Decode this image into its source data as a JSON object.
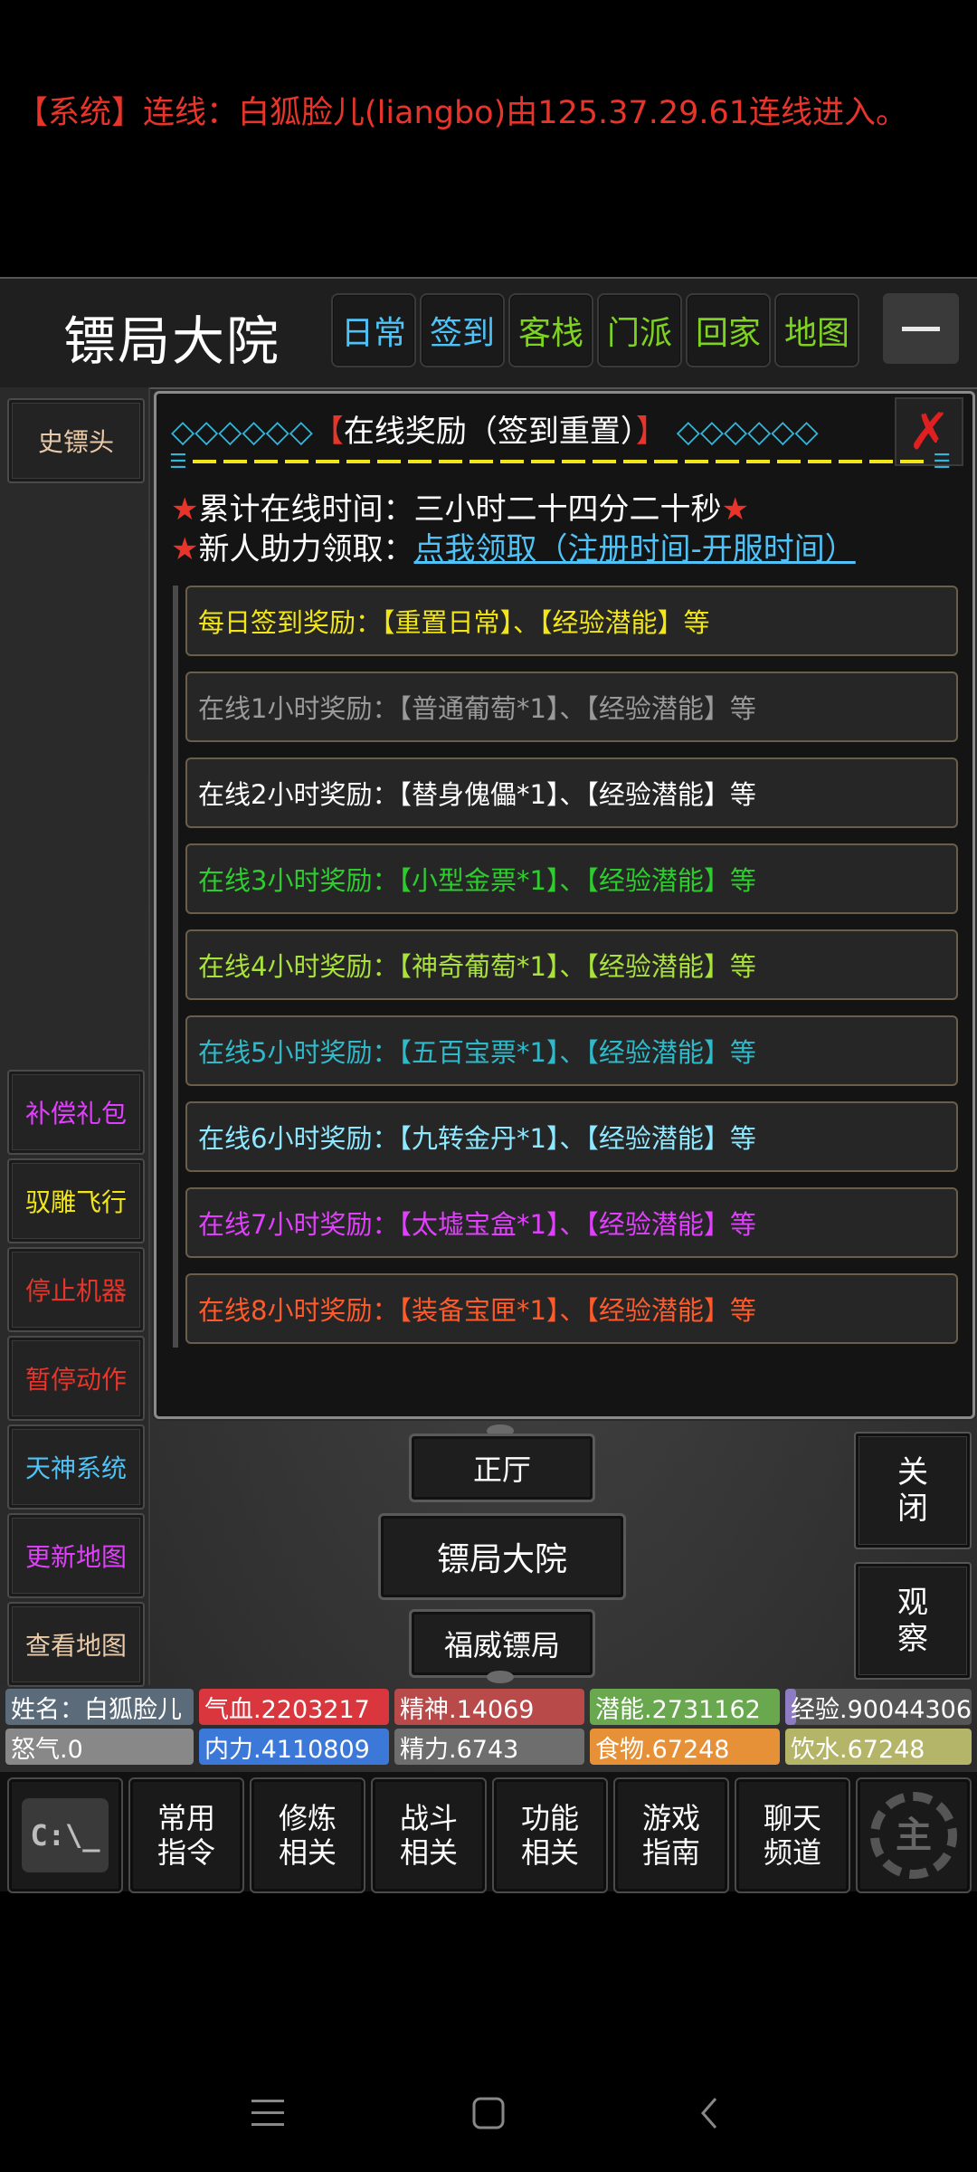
{
  "system_message": "【系统】连线：白狐脸儿(liangbo)由125.37.29.61连线进入。",
  "header": {
    "title": "镖局大院",
    "nav": [
      {
        "label": "日常",
        "color": "#4fc3f7"
      },
      {
        "label": "签到",
        "color": "#4fc3f7"
      },
      {
        "label": "客栈",
        "color": "#7ed321"
      },
      {
        "label": "门派",
        "color": "#7ed321"
      },
      {
        "label": "回家",
        "color": "#7ed321"
      },
      {
        "label": "地图",
        "color": "#7ed321"
      }
    ]
  },
  "sidebar": {
    "top_item": {
      "label": "史镖头",
      "color": "#e8c9a8"
    },
    "items": [
      {
        "label": "补偿礼包",
        "color": "#e040fb"
      },
      {
        "label": "驭雕飞行",
        "color": "#f2e618"
      },
      {
        "label": "停止机器",
        "color": "#e8352b"
      },
      {
        "label": "暂停动作",
        "color": "#e8352b"
      },
      {
        "label": "天神系统",
        "color": "#4fc3f7"
      },
      {
        "label": "更新地图",
        "color": "#e040fb"
      },
      {
        "label": "查看地图",
        "color": "#e8c9a8"
      }
    ]
  },
  "dialog": {
    "title_left": "◇◇◇◇◇◇",
    "title_open": "【",
    "title": "在线奖励（签到重置）",
    "title_close": "】",
    "title_right": "◇◇◇◇◇◇",
    "online_label": "累计在线时间：",
    "online_value": "三小时二十四分二十秒",
    "newbie_label": "新人助力领取：",
    "newbie_link": "点我领取（注册时间-开服时间）",
    "rewards": [
      {
        "text": "每日签到奖励：【重置日常】、【经验潜能】等",
        "color": "#f2e618"
      },
      {
        "text": "在线1小时奖励：【普通葡萄*1】、【经验潜能】等",
        "color": "#9a9a9a"
      },
      {
        "text": "在线2小时奖励：【替身傀儡*1】、【经验潜能】等",
        "color": "#ffffff"
      },
      {
        "text": "在线3小时奖励：【小型金票*1】、【经验潜能】等",
        "color": "#2ecc2e"
      },
      {
        "text": "在线4小时奖励：【神奇葡萄*1】、【经验潜能】等",
        "color": "#a8e23a"
      },
      {
        "text": "在线5小时奖励：【五百宝票*1】、【经验潜能】等",
        "color": "#2fb9c9"
      },
      {
        "text": "在线6小时奖励：【九转金丹*1】、【经验潜能】等",
        "color": "#8ee8ff"
      },
      {
        "text": "在线7小时奖励：【太墟宝盒*1】、【经验潜能】等",
        "color": "#e040fb"
      },
      {
        "text": "在线8小时奖励：【装备宝匣*1】、【经验潜能】等",
        "color": "#ff5a2a"
      }
    ]
  },
  "locations": {
    "north": "正厅",
    "current": "镖局大院",
    "south": "福威镖局"
  },
  "right_buttons": {
    "close": "关闭",
    "observe": "观察"
  },
  "stats": {
    "row1": [
      {
        "text": "姓名：白狐脸儿",
        "color": "#5b6b7a"
      },
      {
        "text": "气血.2203217",
        "color": "#d9363e"
      },
      {
        "text": "精神.14069",
        "color": "#b84a4a"
      },
      {
        "text": "潜能.2731162",
        "color": "#6aa84f"
      },
      {
        "text": "经验.90044306",
        "color": "#8e7cc3"
      }
    ],
    "row2": [
      {
        "text": "怒气.0",
        "color": "#888888"
      },
      {
        "text": "内力.4110809",
        "color": "#3c78d8"
      },
      {
        "text": "精力.6743",
        "color": "#6e6e6e"
      },
      {
        "text": "食物.67248",
        "color": "#e69138"
      },
      {
        "text": "饮水.67248",
        "color": "#b5b56a"
      }
    ]
  },
  "menu": {
    "terminal_icon": "C:\\_",
    "items": [
      {
        "label": "常用指令"
      },
      {
        "label": "修炼相关"
      },
      {
        "label": "战斗相关"
      },
      {
        "label": "功能相关"
      },
      {
        "label": "游戏指南"
      },
      {
        "label": "聊天频道"
      }
    ],
    "gear_glyph": "主"
  }
}
